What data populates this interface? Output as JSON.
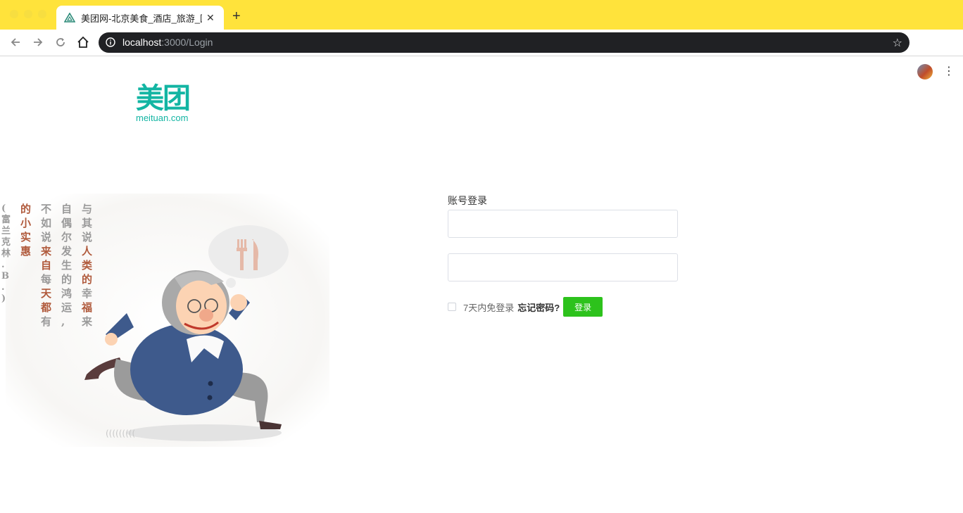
{
  "browser": {
    "tab_title": "美团网-北京美食_酒店_旅游_团购",
    "url_host": "localhost",
    "url_path": ":3000/Login"
  },
  "logo": {
    "cn": "美团",
    "en": "meituan.com",
    "color": "#13b5a3"
  },
  "login": {
    "heading": "账号登录",
    "username_value": "",
    "password_value": "",
    "remember_label": "7天内免登录",
    "forgot_label": "忘记密码?",
    "submit_label": "登录",
    "button_color": "#2dc21c"
  },
  "illustration": {
    "quote_lines": [
      "与其说人类的幸福来",
      "自偶尔发生的鸿运,",
      "不如说来自每天都有",
      "的小实惠",
      "(富兰克林.B.)"
    ]
  },
  "icons": [
    "back-icon",
    "forward-icon",
    "reload-icon",
    "home-icon",
    "info-icon",
    "star-icon",
    "menu-icon",
    "fork-knife-icon"
  ]
}
